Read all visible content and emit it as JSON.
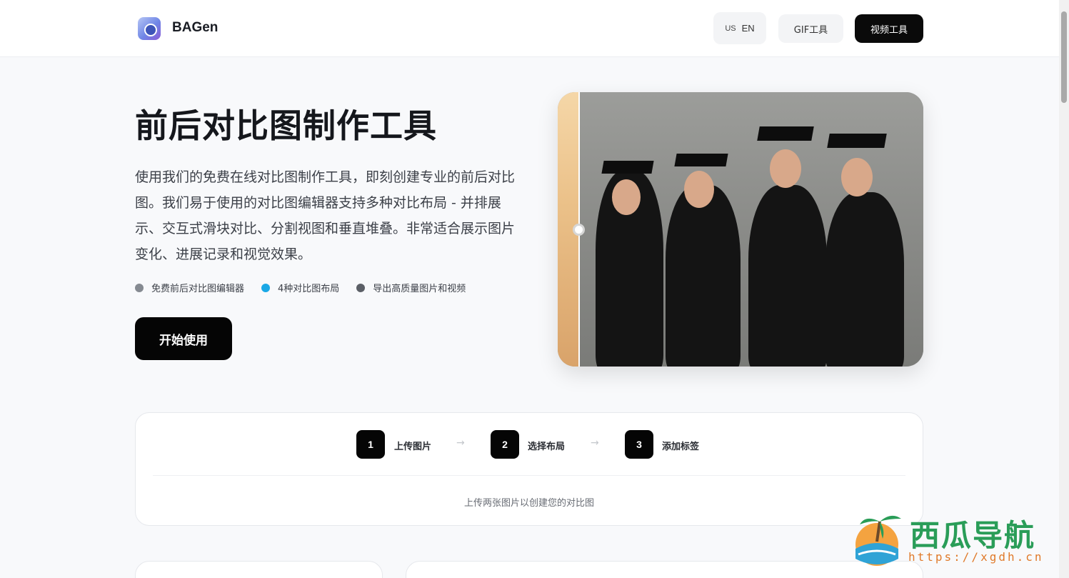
{
  "header": {
    "brand": "BAGen",
    "lang_flag": "US",
    "lang_code": "EN",
    "gif_tool": "GIF工具",
    "video_tool": "视频工具"
  },
  "hero": {
    "title": "前后对比图制作工具",
    "description": "使用我们的免费在线对比图制作工具，即刻创建专业的前后对比图。我们易于使用的对比图编辑器支持多种对比布局 - 并排展示、交互式滑块对比、分割视图和垂直堆叠。非常适合展示图片变化、进展记录和视觉效果。",
    "features": [
      {
        "label": "免费前后对比图编辑器",
        "color": "#858a91"
      },
      {
        "label": "4种对比图布局",
        "color": "#1aa8e6"
      },
      {
        "label": "导出高质量图片和视频",
        "color": "#5b5f66"
      }
    ],
    "start_button": "开始使用"
  },
  "steps": {
    "items": [
      {
        "number": "1",
        "label": "上传图片"
      },
      {
        "number": "2",
        "label": "选择布局"
      },
      {
        "number": "3",
        "label": "添加标签"
      }
    ],
    "arrow": "→",
    "hint": "上传两张图片以创建您的对比图"
  },
  "watermark": {
    "title": "西瓜导航",
    "url": "https://xgdh.cn"
  }
}
